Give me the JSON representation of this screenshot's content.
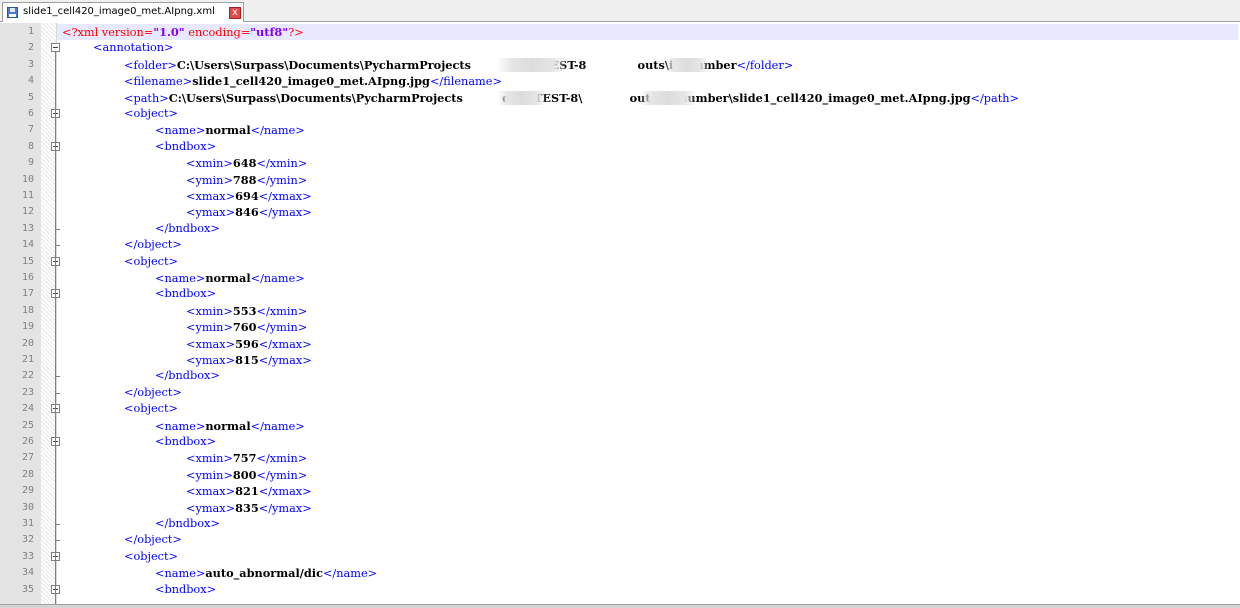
{
  "tab": {
    "filename": "slide1_cell420_image0_met.AIpng.xml",
    "close_glyph": "x"
  },
  "colors": {
    "tag": "#0000ff",
    "text": "#000000",
    "pi": "#ff0000",
    "pi_string": "#8000ff",
    "current_line": "#e8e8ff"
  },
  "lines": [
    {
      "n": "1",
      "parts": [
        [
          "pi",
          "<?xml version="
        ],
        [
          "pistr",
          "\"1.0\""
        ],
        [
          "pi",
          " encoding="
        ],
        [
          "pistr",
          "\"utf8\""
        ],
        [
          "pi",
          "?>"
        ]
      ]
    },
    {
      "n": "2",
      "parts": [
        [
          "tag",
          "<annotation>"
        ]
      ]
    },
    {
      "n": "3",
      "parts": [
        [
          "tag",
          "<folder>"
        ],
        [
          "txt",
          "C:\\Users\\Surpass\\Documents\\PycharmProjects          data\\TEST-8             outs\\in_number"
        ],
        [
          "tag",
          "</folder>"
        ]
      ]
    },
    {
      "n": "4",
      "parts": [
        [
          "tag",
          "<filename>"
        ],
        [
          "txt",
          "slide1_cell420_image0_met.AIpng.jpg"
        ],
        [
          "tag",
          "</filename>"
        ]
      ]
    },
    {
      "n": "5",
      "parts": [
        [
          "tag",
          "<path>"
        ],
        [
          "txt",
          "C:\\Users\\Surpass\\Documents\\PycharmProjects          data\\TEST-8\\            outs\\in_number\\slide1_cell420_image0_met.AIpng.jpg"
        ],
        [
          "tag",
          "</path>"
        ]
      ]
    },
    {
      "n": "6",
      "parts": [
        [
          "tag",
          "<object>"
        ]
      ]
    },
    {
      "n": "7",
      "parts": [
        [
          "tag",
          "<name>"
        ],
        [
          "txt",
          "normal"
        ],
        [
          "tag",
          "</name>"
        ]
      ]
    },
    {
      "n": "8",
      "parts": [
        [
          "tag",
          "<bndbox>"
        ]
      ]
    },
    {
      "n": "9",
      "parts": [
        [
          "tag",
          "<xmin>"
        ],
        [
          "txt",
          "648"
        ],
        [
          "tag",
          "</xmin>"
        ]
      ]
    },
    {
      "n": "10",
      "parts": [
        [
          "tag",
          "<ymin>"
        ],
        [
          "txt",
          "788"
        ],
        [
          "tag",
          "</ymin>"
        ]
      ]
    },
    {
      "n": "11",
      "parts": [
        [
          "tag",
          "<xmax>"
        ],
        [
          "txt",
          "694"
        ],
        [
          "tag",
          "</xmax>"
        ]
      ]
    },
    {
      "n": "12",
      "parts": [
        [
          "tag",
          "<ymax>"
        ],
        [
          "txt",
          "846"
        ],
        [
          "tag",
          "</ymax>"
        ]
      ]
    },
    {
      "n": "13",
      "parts": [
        [
          "tag",
          "</bndbox>"
        ]
      ]
    },
    {
      "n": "14",
      "parts": [
        [
          "tag",
          "</object>"
        ]
      ]
    },
    {
      "n": "15",
      "parts": [
        [
          "tag",
          "<object>"
        ]
      ]
    },
    {
      "n": "16",
      "parts": [
        [
          "tag",
          "<name>"
        ],
        [
          "txt",
          "normal"
        ],
        [
          "tag",
          "</name>"
        ]
      ]
    },
    {
      "n": "17",
      "parts": [
        [
          "tag",
          "<bndbox>"
        ]
      ]
    },
    {
      "n": "18",
      "parts": [
        [
          "tag",
          "<xmin>"
        ],
        [
          "txt",
          "553"
        ],
        [
          "tag",
          "</xmin>"
        ]
      ]
    },
    {
      "n": "19",
      "parts": [
        [
          "tag",
          "<ymin>"
        ],
        [
          "txt",
          "760"
        ],
        [
          "tag",
          "</ymin>"
        ]
      ]
    },
    {
      "n": "20",
      "parts": [
        [
          "tag",
          "<xmax>"
        ],
        [
          "txt",
          "596"
        ],
        [
          "tag",
          "</xmax>"
        ]
      ]
    },
    {
      "n": "21",
      "parts": [
        [
          "tag",
          "<ymax>"
        ],
        [
          "txt",
          "815"
        ],
        [
          "tag",
          "</ymax>"
        ]
      ]
    },
    {
      "n": "22",
      "parts": [
        [
          "tag",
          "</bndbox>"
        ]
      ]
    },
    {
      "n": "23",
      "parts": [
        [
          "tag",
          "</object>"
        ]
      ]
    },
    {
      "n": "24",
      "parts": [
        [
          "tag",
          "<object>"
        ]
      ]
    },
    {
      "n": "25",
      "parts": [
        [
          "tag",
          "<name>"
        ],
        [
          "txt",
          "normal"
        ],
        [
          "tag",
          "</name>"
        ]
      ]
    },
    {
      "n": "26",
      "parts": [
        [
          "tag",
          "<bndbox>"
        ]
      ]
    },
    {
      "n": "27",
      "parts": [
        [
          "tag",
          "<xmin>"
        ],
        [
          "txt",
          "757"
        ],
        [
          "tag",
          "</xmin>"
        ]
      ]
    },
    {
      "n": "28",
      "parts": [
        [
          "tag",
          "<ymin>"
        ],
        [
          "txt",
          "800"
        ],
        [
          "tag",
          "</ymin>"
        ]
      ]
    },
    {
      "n": "29",
      "parts": [
        [
          "tag",
          "<xmax>"
        ],
        [
          "txt",
          "821"
        ],
        [
          "tag",
          "</xmax>"
        ]
      ]
    },
    {
      "n": "30",
      "parts": [
        [
          "tag",
          "<ymax>"
        ],
        [
          "txt",
          "835"
        ],
        [
          "tag",
          "</ymax>"
        ]
      ]
    },
    {
      "n": "31",
      "parts": [
        [
          "tag",
          "</bndbox>"
        ]
      ]
    },
    {
      "n": "32",
      "parts": [
        [
          "tag",
          "</object>"
        ]
      ]
    },
    {
      "n": "33",
      "parts": [
        [
          "tag",
          "<object>"
        ]
      ]
    },
    {
      "n": "34",
      "parts": [
        [
          "tag",
          "<name>"
        ],
        [
          "txt",
          "auto_abnormal/dic"
        ],
        [
          "tag",
          "</name>"
        ]
      ]
    },
    {
      "n": "35",
      "parts": [
        [
          "tag",
          "<bndbox>"
        ]
      ]
    }
  ]
}
